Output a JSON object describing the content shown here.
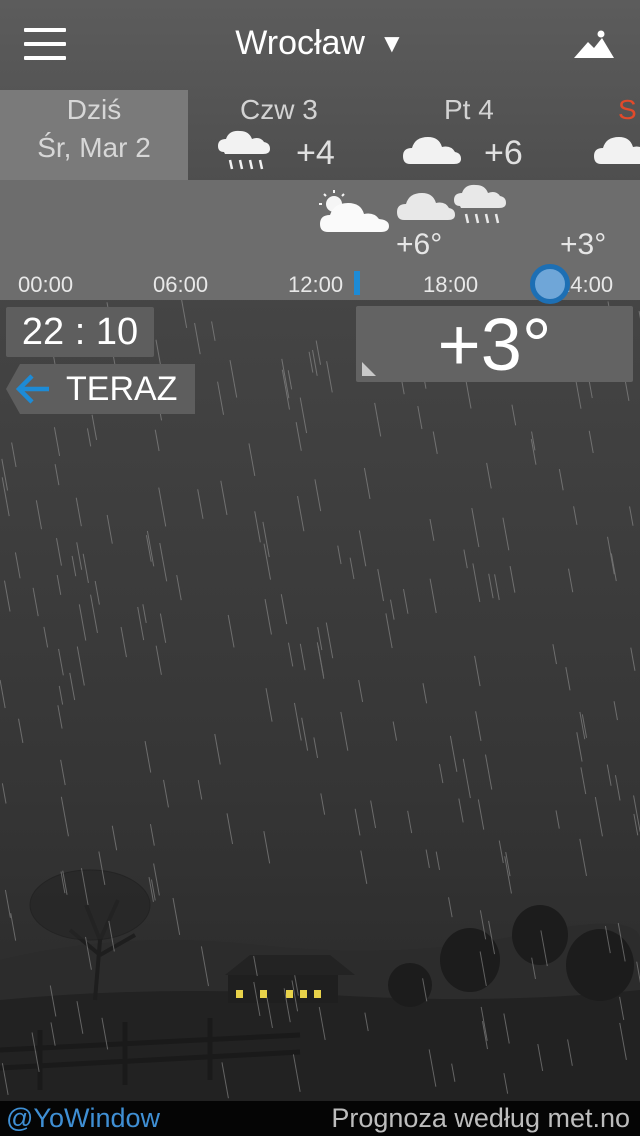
{
  "header": {
    "city": "Wrocław",
    "city_caret": "▼",
    "menu_icon": "hamburger-menu-icon",
    "landscape_icon": "landscape-icon"
  },
  "days": [
    {
      "line1": "Dziś",
      "line2": "Śr, Mar 2",
      "selected": true
    },
    {
      "name": "Czw 3",
      "temp": "+4",
      "icon": "rain-cloud-icon"
    },
    {
      "name": "Pt 4",
      "temp": "+6",
      "icon": "cloud-icon"
    },
    {
      "name": "S",
      "icon": "cloud-icon",
      "color": "#e24a2a"
    }
  ],
  "hourly": {
    "temps": [
      "+6°",
      "+3°"
    ],
    "ticks": [
      "00:00",
      "06:00",
      "12:00",
      "18:00",
      "24:00"
    ],
    "icons": [
      "partly-cloudy-icon",
      "cloud-icon",
      "rain-cloud-icon"
    ],
    "now_color": "#1d8bd6"
  },
  "time_box": {
    "hours": "22",
    "minutes": "10"
  },
  "now_button": {
    "label": "TERAZ",
    "icon": "arrow-left-icon"
  },
  "current_temp": "+3°",
  "footer": {
    "brand": "@YoWindow",
    "credit": "Prognoza według met.no"
  },
  "colors": {
    "accent": "#1d8bd6",
    "today_tab": "#7a7a7a",
    "hourly_strip": "#6d6d6d",
    "brand_link": "#3f8fd4"
  }
}
